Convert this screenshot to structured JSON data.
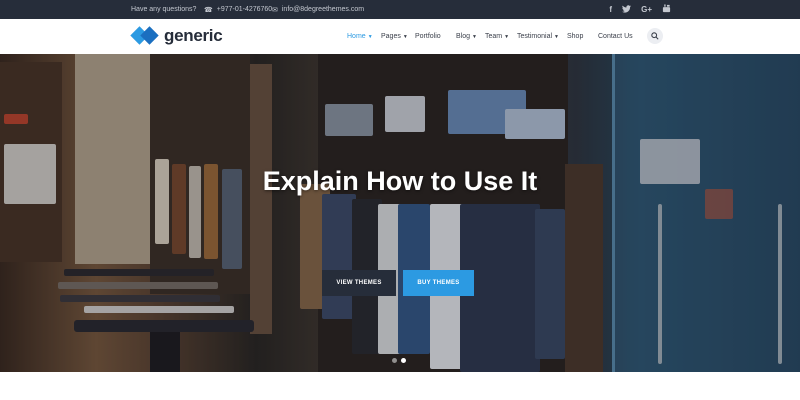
{
  "topbar": {
    "question": "Have any questions?",
    "phone": "+977-01-4276760",
    "email": "info@8degreethemes.com",
    "social": [
      "f",
      "t",
      "G+",
      "yt"
    ]
  },
  "header": {
    "logo_text": "generic",
    "nav": [
      "Home",
      "Pages",
      "Portfolio",
      "Blog",
      "Team",
      "Testimonial",
      "Shop",
      "Contact Us"
    ],
    "active_nav": "Home"
  },
  "hero": {
    "title": "Explain How to Use It",
    "view_button": "VIEW THEMES",
    "buy_button": "BUY THEMES",
    "slides": 2,
    "active_slide": 2
  },
  "colors": {
    "topbar_bg": "#262d3a",
    "accent": "#2c9ae2",
    "dark_button": "#262d3a"
  },
  "icons": {
    "phone": "phone-icon",
    "email": "envelope-icon",
    "search": "search-icon"
  }
}
